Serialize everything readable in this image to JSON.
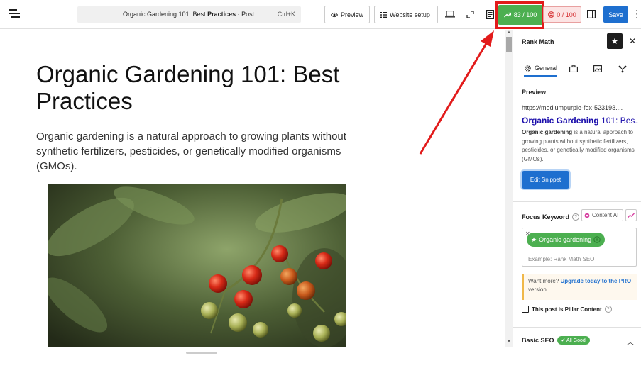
{
  "topbar": {
    "doc_title_main": "Organic Gardening 101: Best ",
    "doc_title_bold": "Practices",
    "doc_title_suffix": " · Post",
    "shortcut": "Ctrl+K",
    "preview_label": "Preview",
    "website_setup_label": "Website setup",
    "seo_score": "83 / 100",
    "readability_score": "0 / 100",
    "save_label": "Save"
  },
  "post": {
    "title": "Organic Gardening 101: Best Practices",
    "intro": "Organic gardening is a natural approach to growing plants without synthetic fertilizers, pesticides, or genetically modified organisms (GMOs)."
  },
  "sidebar": {
    "title": "Rank Math",
    "tab_general": "General",
    "preview_heading": "Preview",
    "preview_url": "https://mediumpurple-fox-523193....",
    "preview_title_bold": "Organic Gardening",
    "preview_title_rest": " 101: Bes...",
    "preview_desc_bold": "Organic gardening",
    "preview_desc_rest": " is a natural approach to growing plants without synthetic fertilizers, pesticides, or genetically modified organisms (GMOs).",
    "edit_snippet_label": "Edit Snippet",
    "focus_keyword_label": "Focus Keyword",
    "content_ai_label": "Content AI",
    "keyword": "Organic gardening",
    "keyword_placeholder": "Example: Rank Math SEO",
    "pro_text_before": "Want more? ",
    "pro_link": "Upgrade today to the PRO",
    "pro_text_after": " version.",
    "pillar_label": "This post is Pillar Content",
    "basic_seo_label": "Basic SEO",
    "basic_seo_badge": "✔ All Good"
  },
  "colors": {
    "score_good": "#4caf50",
    "score_bad": "#d63638",
    "primary": "#1e6fcf",
    "annotation": "#e21b1b"
  }
}
